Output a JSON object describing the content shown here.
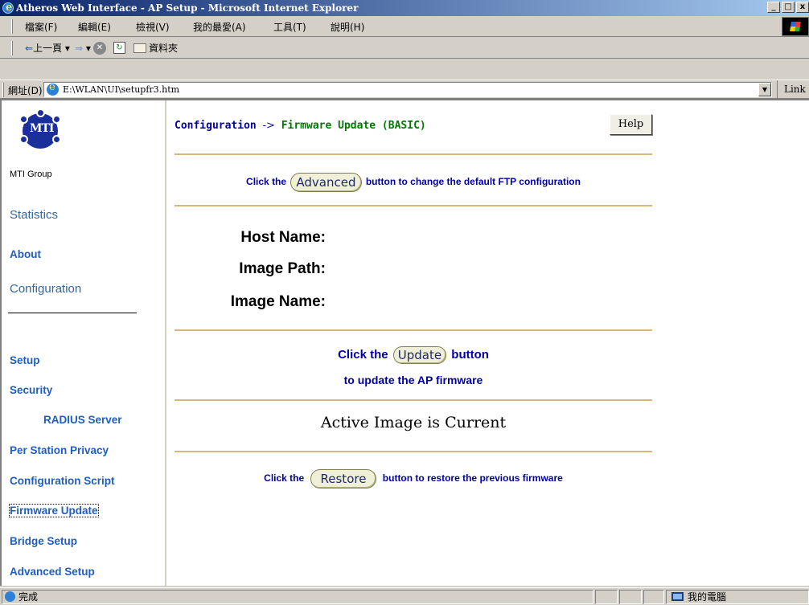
{
  "window": {
    "title": "Atheros Web Interface - AP Setup - Microsoft Internet Explorer",
    "controls": [
      "_",
      "□",
      "x"
    ]
  },
  "menubar": {
    "items": [
      "檔案(F)",
      "編輯(E)",
      "檢視(V)",
      "我的最愛(A)",
      "工具(T)",
      "說明(H)"
    ]
  },
  "toolbar": {
    "back_label": "上一頁",
    "folders_label": "資料夾"
  },
  "address": {
    "label": "網址(D)",
    "value": "E:\\WLAN\\UI\\setupfr3.htm",
    "links_label": "Link"
  },
  "nav": {
    "logo_caption": "MTI Group",
    "top_links": [
      "Statistics",
      "About",
      "Configuration"
    ],
    "links": [
      {
        "label": "Setup",
        "indent": false,
        "active": false
      },
      {
        "label": "Security",
        "indent": false,
        "active": false
      },
      {
        "label": "RADIUS Server",
        "indent": true,
        "active": false
      },
      {
        "label": "Per Station Privacy",
        "indent": false,
        "active": false
      },
      {
        "label": "Configuration Script",
        "indent": false,
        "active": false
      },
      {
        "label": "Firmware Update",
        "indent": false,
        "active": true
      },
      {
        "label": "Bridge Setup",
        "indent": false,
        "active": false
      },
      {
        "label": "Advanced Setup",
        "indent": false,
        "active": false
      }
    ]
  },
  "main": {
    "breadcrumb_root": "Configuration",
    "breadcrumb_arrow": "->",
    "breadcrumb_page": "Firmware Update (BASIC)",
    "help_label": "Help",
    "advanced_pre": "Click the",
    "advanced_button": "Advanced",
    "advanced_post": "button to change the default FTP configuration",
    "fields": [
      "Host Name:",
      "Image Path:",
      "Image Name:"
    ],
    "update_pre": "Click the",
    "update_button": "Update",
    "update_post": "button",
    "update_line2": "to update the AP firmware",
    "active_status": "Active Image is Current",
    "restore_pre": "Click the",
    "restore_button": "Restore",
    "restore_post": "button to restore the previous firmware"
  },
  "status": {
    "text": "完成",
    "zone": "我的電腦"
  }
}
